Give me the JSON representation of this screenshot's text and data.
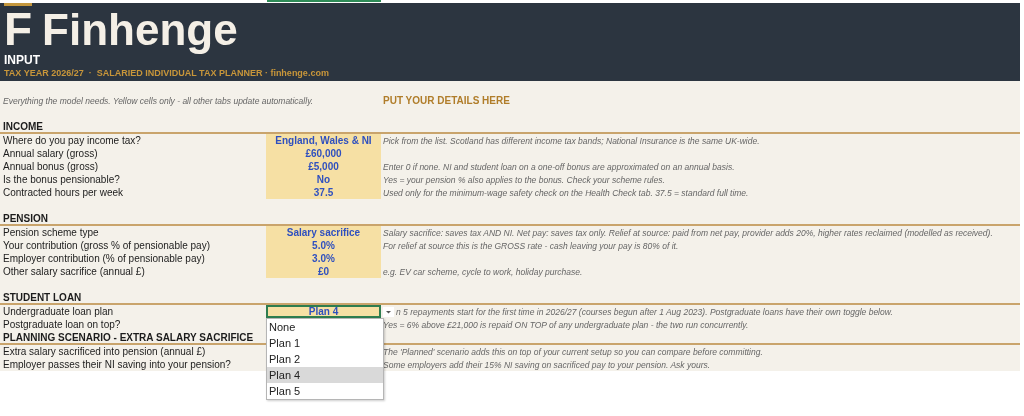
{
  "header": {
    "logo_mark": "F",
    "brand": "Finhenge",
    "sheet_title": "INPUT",
    "subtitle": "TAX YEAR 2026/27  ·  SALARIED INDIVIDUAL TAX PLANNER · finhenge.com"
  },
  "intro": {
    "note": "Everything the model needs. Yellow cells only - all other tabs update automatically.",
    "callout": "PUT YOUR DETAILS HERE"
  },
  "sections": [
    {
      "title": "INCOME",
      "rows": [
        {
          "kind": "field",
          "label": "Where do you pay income tax?",
          "value": "England, Wales & NI",
          "active": false,
          "note": "Pick from the list. Scotland has different income tax bands; National Insurance is the same UK-wide."
        },
        {
          "kind": "field",
          "label": "Annual salary (gross)",
          "value": "£60,000",
          "active": false
        },
        {
          "kind": "field",
          "label": "Annual bonus (gross)",
          "value": "£5,000",
          "active": false,
          "note": "Enter 0 if none. NI and student loan on a one-off bonus are approximated on an annual basis."
        },
        {
          "kind": "field",
          "label": "Is the bonus pensionable?",
          "value": "No",
          "active": false,
          "note": "Yes = your pension % also applies to the bonus. Check your scheme rules."
        },
        {
          "kind": "field",
          "label": "Contracted hours per week",
          "value": "37.5",
          "active": false,
          "note": "Used only for the minimum-wage safety check on the Health Check tab. 37.5 = standard full time."
        },
        {
          "kind": "blank"
        }
      ]
    },
    {
      "title": "PENSION",
      "rows": [
        {
          "kind": "field",
          "label": "Pension scheme type",
          "value": "Salary sacrifice",
          "active": false,
          "note": "Salary sacrifice: saves tax AND NI.  Net pay: saves tax only.  Relief at source: paid from net pay, provider adds 20%, higher rates reclaimed (modelled as received)."
        },
        {
          "kind": "field",
          "label": "Your contribution (gross % of pensionable pay)",
          "value": "5.0%",
          "active": false,
          "note": "For relief at source this is the GROSS rate - cash leaving your pay is 80% of it."
        },
        {
          "kind": "field",
          "label": "Employer contribution (% of pensionable pay)",
          "value": "3.0%",
          "active": false
        },
        {
          "kind": "field",
          "label": "Other salary sacrifice (annual £)",
          "value": "£0",
          "active": false,
          "note": "e.g. EV car scheme, cycle to work, holiday purchase."
        },
        {
          "kind": "blank"
        }
      ]
    },
    {
      "title": "STUDENT LOAN",
      "rows": [
        {
          "kind": "field",
          "label": "Undergraduate loan plan",
          "value": "Plan 4",
          "active": true,
          "note": "n 5 repayments start for the first time in 2026/27 (courses begun after 1 Aug 2023). Postgraduate loans have their own toggle below."
        },
        {
          "kind": "field",
          "label": "Postgraduate loan on top?",
          "note": "Yes = 6% above £21,000 is repaid ON TOP of any undergraduate plan - the two run concurrently."
        }
      ]
    },
    {
      "title": "PLANNING SCENARIO - EXTRA SALARY SACRIFICE",
      "rows": [
        {
          "kind": "field",
          "label": "Extra salary sacrificed into pension (annual £)",
          "note": "The 'Planned' scenario adds this on top of your current setup so you can compare before committing."
        },
        {
          "kind": "field",
          "label": "Employer passes their NI saving into your pension?",
          "note": "Some employers add their 15% NI saving on sacrificed pay to your pension. Ask yours."
        }
      ]
    }
  ],
  "dropdown": {
    "options": [
      {
        "label": "None",
        "selected": false
      },
      {
        "label": "Plan 1",
        "selected": false
      },
      {
        "label": "Plan 2",
        "selected": false
      },
      {
        "label": "Plan 4",
        "selected": true
      },
      {
        "label": "Plan 5",
        "selected": false
      }
    ]
  }
}
